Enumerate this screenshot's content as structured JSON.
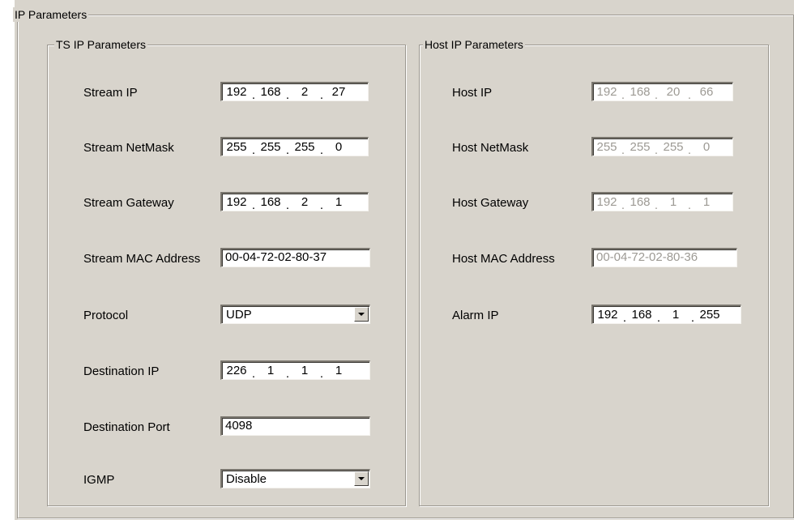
{
  "outer_group": {
    "title": "IP Parameters"
  },
  "ts_group": {
    "title": "TS IP Parameters",
    "stream_ip": {
      "label": "Stream IP",
      "octets": [
        "192",
        "168",
        "2",
        "27"
      ]
    },
    "stream_netmask": {
      "label": "Stream NetMask",
      "octets": [
        "255",
        "255",
        "255",
        "0"
      ]
    },
    "stream_gateway": {
      "label": "Stream Gateway",
      "octets": [
        "192",
        "168",
        "2",
        "1"
      ]
    },
    "stream_mac": {
      "label": "Stream MAC Address",
      "value": "00-04-72-02-80-37"
    },
    "protocol": {
      "label": "Protocol",
      "value": "UDP"
    },
    "destination_ip": {
      "label": "Destination  IP",
      "octets": [
        "226",
        "1",
        "1",
        "1"
      ]
    },
    "destination_port": {
      "label": "Destination  Port",
      "value": "4098"
    },
    "igmp": {
      "label": "IGMP",
      "value": "Disable"
    }
  },
  "host_group": {
    "title": "Host IP Parameters",
    "host_ip": {
      "label": "Host IP",
      "octets": [
        "192",
        "168",
        "20",
        "66"
      ]
    },
    "host_netmask": {
      "label": "Host NetMask",
      "octets": [
        "255",
        "255",
        "255",
        "0"
      ]
    },
    "host_gateway": {
      "label": "Host Gateway",
      "octets": [
        "192",
        "168",
        "1",
        "1"
      ]
    },
    "host_mac": {
      "label": "Host MAC Address",
      "value": "00-04-72-02-80-36"
    },
    "alarm_ip": {
      "label": "Alarm  IP",
      "octets": [
        "192",
        "168",
        "1",
        "255"
      ]
    }
  },
  "icons": {
    "dropdown": "chevron-down-icon"
  },
  "colors": {
    "panel": "#d8d4cc",
    "disabled_text": "#9d9a94"
  }
}
